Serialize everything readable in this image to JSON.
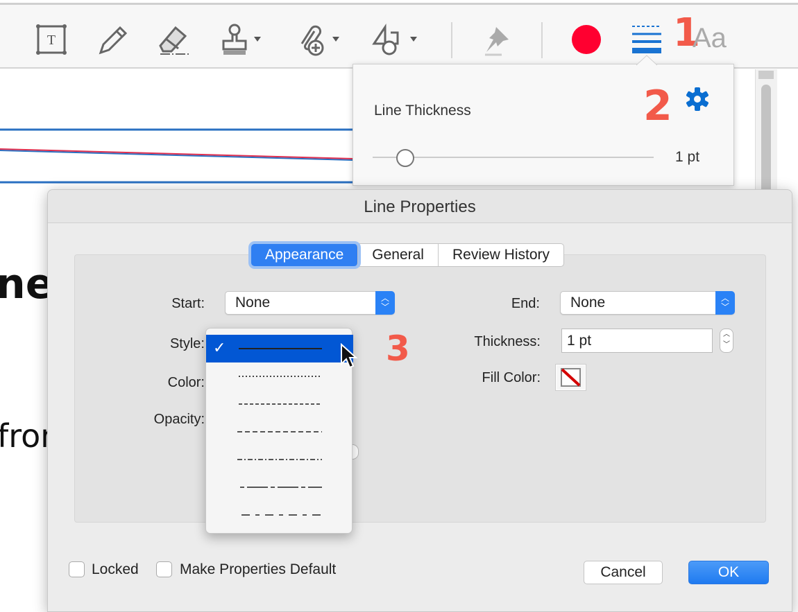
{
  "toolbar": {
    "tools": [
      {
        "icon": "text-box-icon"
      },
      {
        "icon": "pencil-icon"
      },
      {
        "icon": "eraser-icon"
      },
      {
        "icon": "stamp-icon"
      },
      {
        "icon": "attach-icon"
      },
      {
        "icon": "shapes-icon"
      },
      {
        "icon": "pin-icon"
      },
      {
        "icon": "color-circle-icon",
        "color": "#ff0030"
      },
      {
        "icon": "line-thickness-icon",
        "color": "#1a73d2"
      },
      {
        "icon": "font-icon",
        "label": "Aa"
      }
    ],
    "annotation_1": "1"
  },
  "document": {
    "fragment_1": "ne",
    "fragment_2": "fron"
  },
  "popover": {
    "title": "Line Thickness",
    "annotation_2": "2",
    "value": "1 pt",
    "slider_fraction": 0.1,
    "gear_color": "#0a6ed1"
  },
  "dialog": {
    "title": "Line Properties",
    "tabs": [
      {
        "label": "Appearance",
        "active": true
      },
      {
        "label": "General"
      },
      {
        "label": "Review History"
      }
    ],
    "start_label": "Start:",
    "start_value": "None",
    "end_label": "End:",
    "end_value": "None",
    "style_label": "Style:",
    "color_label": "Color:",
    "opacity_label": "Opacity:",
    "thickness_label": "Thickness:",
    "thickness_value": "1 pt",
    "fill_color_label": "Fill Color:",
    "fill_color": "none",
    "annotation_3": "3",
    "style_menu": {
      "check": "✓",
      "items": [
        "solid",
        "dotted",
        "dashed-short",
        "dashed",
        "dash-dot",
        "dash-long-dash",
        "dash-long-short"
      ],
      "selected": "solid"
    },
    "locked_label": "Locked",
    "locked": false,
    "default_label": "Make Properties Default",
    "default_checked": false,
    "cancel_label": "Cancel",
    "ok_label": "OK"
  }
}
